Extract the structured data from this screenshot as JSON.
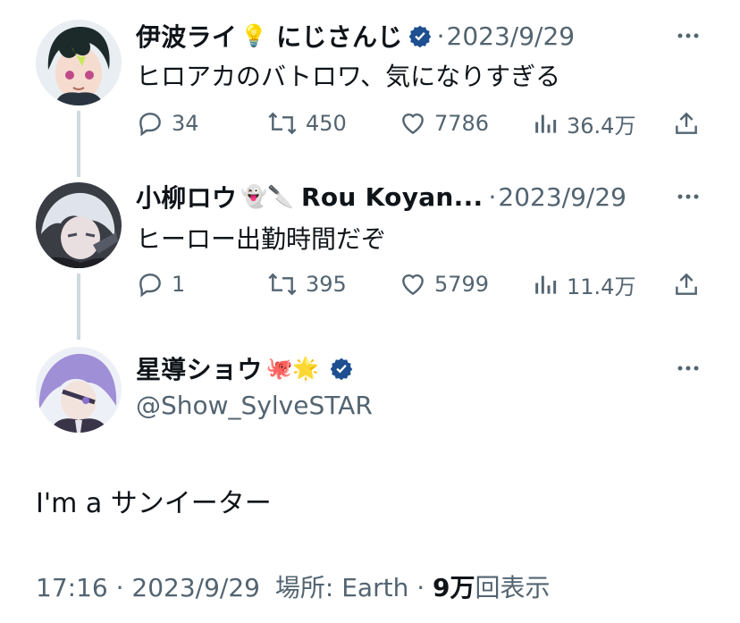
{
  "tweets": [
    {
      "name": "伊波ライ",
      "emoji": "💡",
      "name_suffix": "にじさんじ",
      "verified": true,
      "date": "2023/9/29",
      "text": "ヒロアカのバトロワ、気になりすぎる",
      "replies": "34",
      "retweets": "450",
      "likes": "7786",
      "views": "36.4万"
    },
    {
      "name": "小柳ロウ",
      "emoji": "👻🔪",
      "name_suffix": "Rou Koyan...",
      "verified": false,
      "date": "2023/9/29",
      "text": "ヒーロー出勤時間だぞ",
      "replies": "1",
      "retweets": "395",
      "likes": "5799",
      "views": "11.4万"
    }
  ],
  "main": {
    "name": "星導ショウ",
    "emoji": "🐙🌟",
    "verified": true,
    "handle": "@Show_SylveSTAR",
    "text": "I'm a サンイーター",
    "time": "17:16",
    "date": "2023/9/29",
    "location": "場所: Earth",
    "views_count": "9万",
    "views_label": "回表示"
  },
  "colors": {
    "text": "#0f1419",
    "secondary": "#536471",
    "thread_line": "#cfd9de",
    "verified_blue": "#1d4f91"
  }
}
